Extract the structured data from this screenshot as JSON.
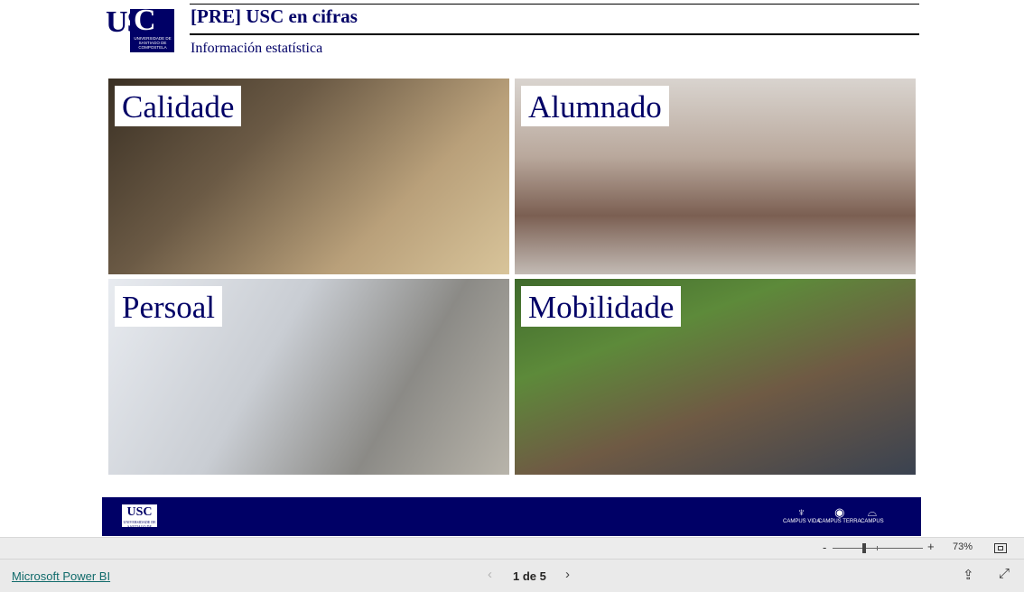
{
  "header": {
    "logo_text": "USC",
    "logo_subtext": "UNIVERSIDADE DE SANTIAGO DE COMPOSTELA",
    "title": "[PRE] USC en cifras",
    "subtitle": "Información estatística"
  },
  "tiles": [
    {
      "label": "Calidade"
    },
    {
      "label": "Alumnado"
    },
    {
      "label": "Persoal"
    },
    {
      "label": "Mobilidade"
    }
  ],
  "footer": {
    "logo_text": "USC",
    "logo_subtext": "UNIVERSIDADE DE SANTIAGO DE COMPOSTELA",
    "partners": [
      "CAMPUS VIDA",
      "CAMPUS TERRA",
      "CAMPUS"
    ]
  },
  "zoom": {
    "minus": "-",
    "plus": "+",
    "value": "73%"
  },
  "bottombar": {
    "brand": "Microsoft Power BI",
    "page_indicator": "1 de 5",
    "prev": "‹",
    "next": "›"
  },
  "icons": {
    "share": "share-icon",
    "expand": "expand-icon",
    "fit": "fit-to-page-icon"
  },
  "colors": {
    "brand_navy": "#000066",
    "link": "#116b6b"
  }
}
